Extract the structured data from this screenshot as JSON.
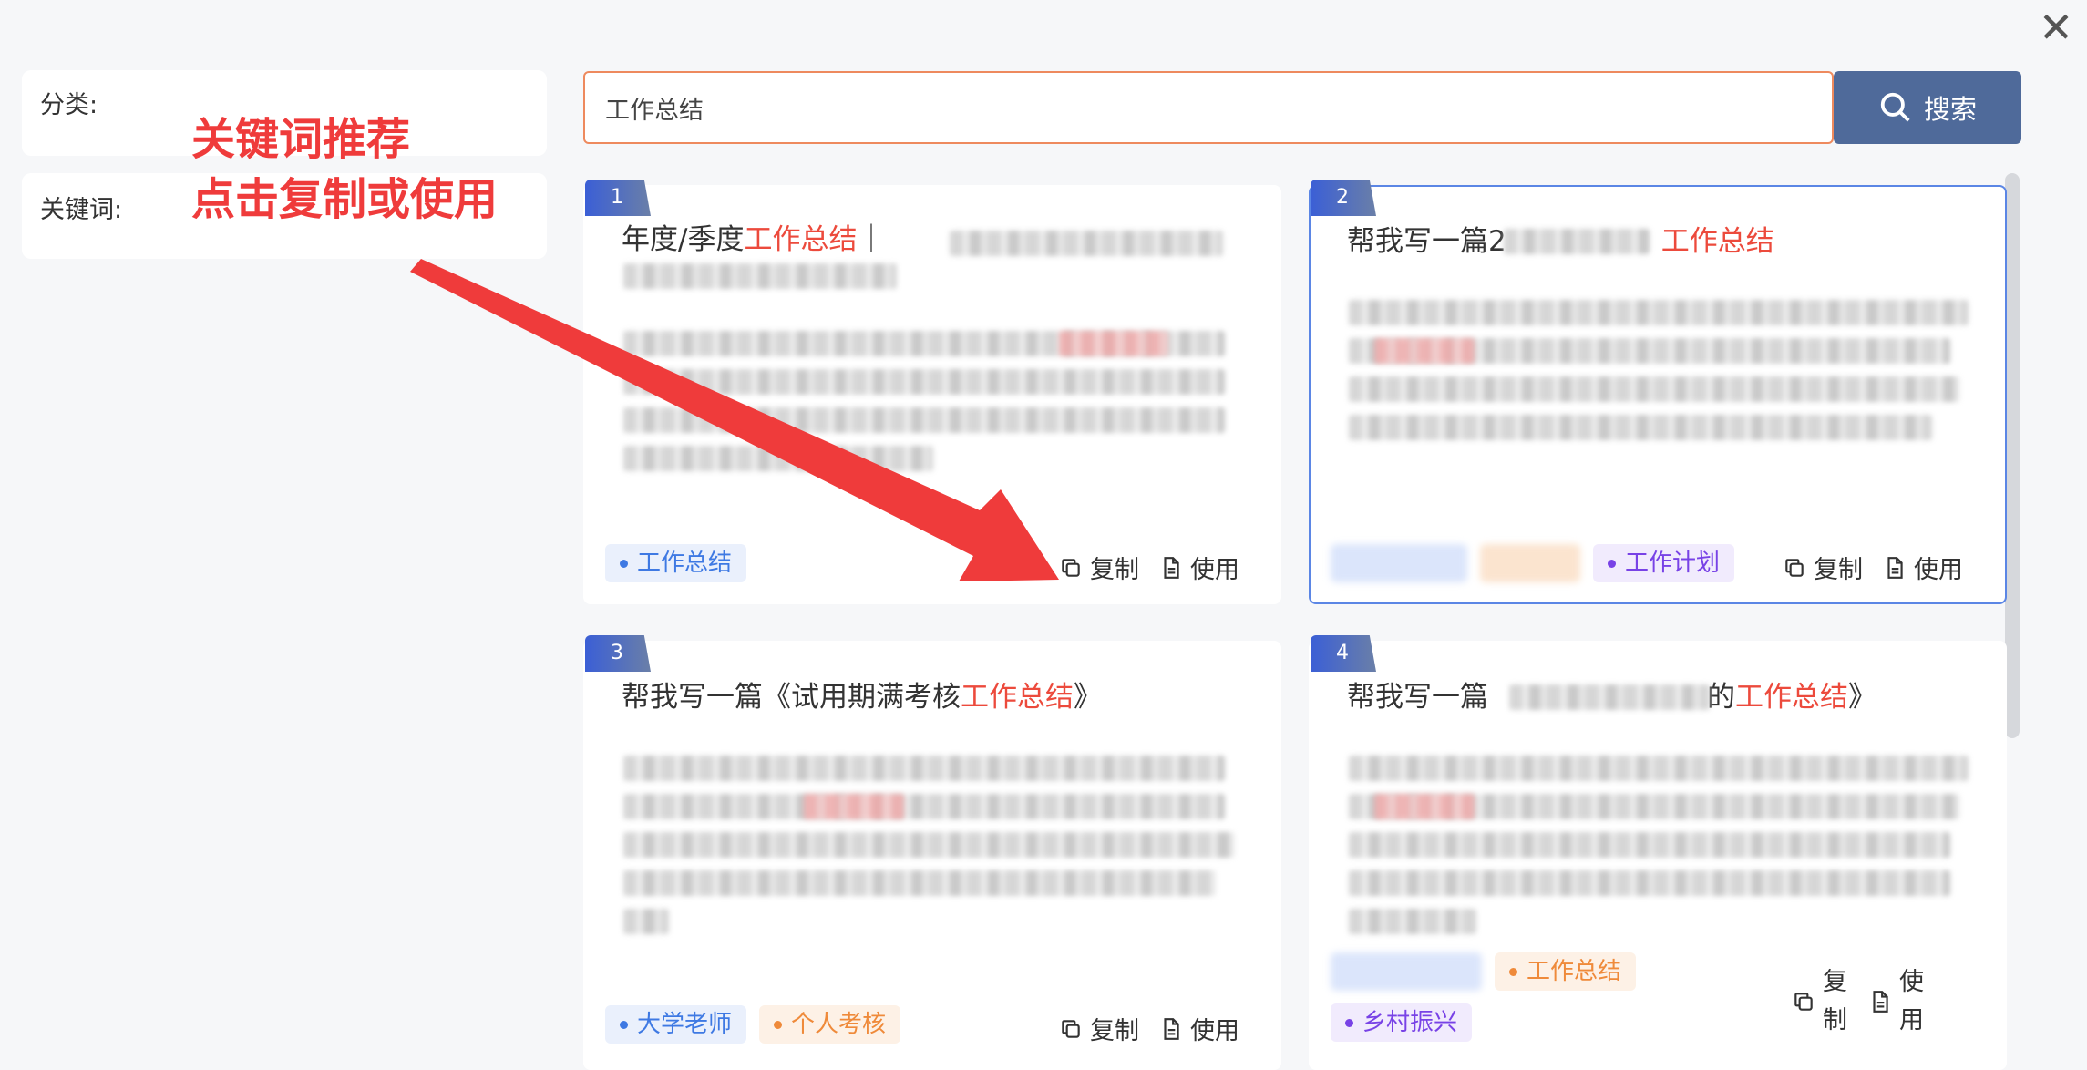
{
  "dialog": {
    "close_icon": "close-icon"
  },
  "sidebar": {
    "category_label": "分类:",
    "keyword_label": "关键词:"
  },
  "annotation": {
    "text": "关键词推荐\n点击复制或使用"
  },
  "search": {
    "value": "工作总结",
    "button_label": "搜索",
    "accent": "#ee8a5e"
  },
  "actions": {
    "copy": "复制",
    "use": "使用"
  },
  "cards": [
    {
      "num": "1",
      "title_prefix": "年度/季度",
      "title_hl": "工作总结",
      "title_suffix": "｜",
      "tags": [
        {
          "label": "工作总结"
        }
      ]
    },
    {
      "num": "2",
      "title_prefix": "帮我写一篇2",
      "title_hl": "工作总结",
      "title_suffix": "",
      "tags": [
        {
          "label": "工作计划"
        }
      ]
    },
    {
      "num": "3",
      "title_prefix": "帮我写一篇《试用期满考核",
      "title_hl": "工作总结",
      "title_suffix": "》",
      "tags": [
        {
          "label": "大学老师"
        },
        {
          "label": "个人考核"
        }
      ]
    },
    {
      "num": "4",
      "title_prefix": "帮我写一篇",
      "title_mid": "的",
      "title_hl": "工作总结",
      "title_suffix": "》",
      "tags": [
        {
          "label": "工作总结"
        },
        {
          "label": "乡村振兴"
        }
      ]
    }
  ]
}
